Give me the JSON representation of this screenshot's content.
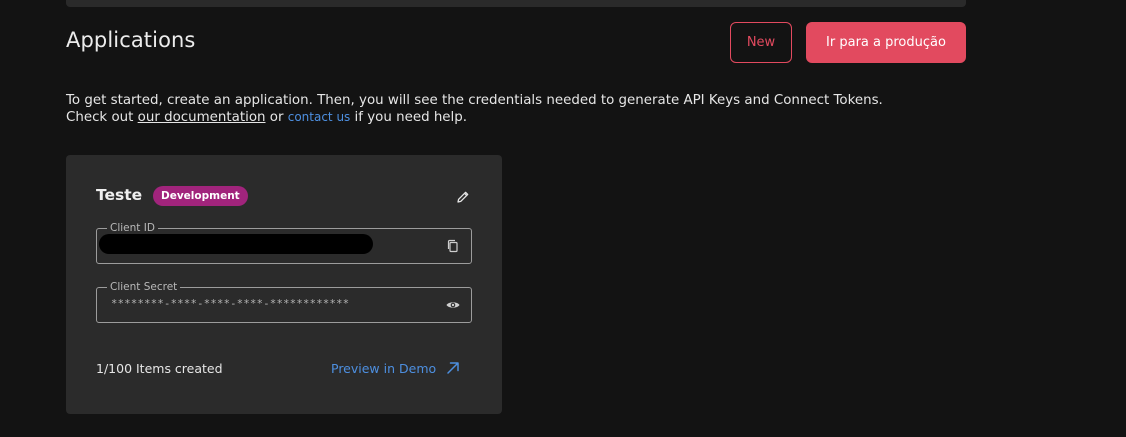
{
  "header": {
    "title": "Applications",
    "new_button": "New",
    "production_button": "Ir para a produção"
  },
  "intro": {
    "line1": "To get started, create an application. Then, you will see the credentials needed to generate API Keys and Connect Tokens.",
    "line2_prefix": "Check out ",
    "documentation_link": "our documentation",
    "or_text": " or ",
    "contact_link": "contact us",
    "line2_suffix": " if you need help."
  },
  "app_card": {
    "name": "Teste",
    "environment": "Development",
    "client_id_label": "Client ID",
    "client_secret_label": "Client Secret",
    "client_secret_value": "********-****-****-****-************",
    "items_count": "1/100 Items created",
    "preview_link": "Preview in Demo",
    "icons": {
      "edit": "pencil-icon",
      "copy": "copy-icon",
      "reveal": "eye-icon",
      "external": "arrow-up-right-icon"
    }
  },
  "colors": {
    "background": "#131313",
    "card": "#2b2b2b",
    "accent": "#e24a5f",
    "badge": "#a1247c",
    "link": "#4d8fe0"
  }
}
